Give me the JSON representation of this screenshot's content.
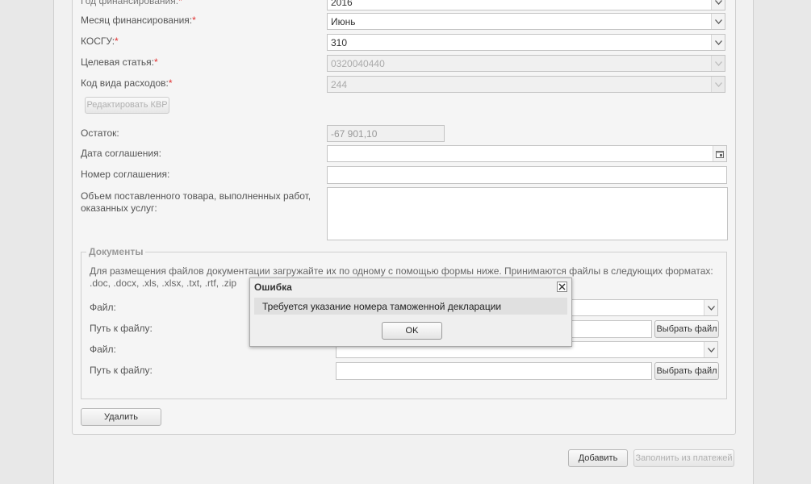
{
  "form": {
    "year": {
      "label": "Год финансирования:",
      "required_mark": "*",
      "value": "2016"
    },
    "month": {
      "label": "Месяц финансирования:",
      "required_mark": "*",
      "value": "Июнь"
    },
    "kosgu": {
      "label": "КОСГУ:",
      "required_mark": "*",
      "value": "310"
    },
    "target": {
      "label": "Целевая статья:",
      "required_mark": "*",
      "value": "0320040440"
    },
    "expense_code": {
      "label": "Код вида расходов:",
      "required_mark": "*",
      "value": "244"
    },
    "edit_kvr_button": "Редактировать КВР",
    "remainder": {
      "label": "Остаток:",
      "value": "-67 901,10"
    },
    "agreement_date": {
      "label": "Дата соглашения:",
      "value": ""
    },
    "agreement_number": {
      "label": "Номер соглашения:",
      "value": ""
    },
    "volume": {
      "label_line1": "Объем поставленного товара, выполненных работ,",
      "label_line2": "оказанных услуг:",
      "value": ""
    }
  },
  "documents": {
    "legend": "Документы",
    "description_line1": "Для размещения файлов документации загружайте их по одному с помощью формы ниже. Принимаются файлы в следующих форматах:",
    "description_line2": ".doc, .docx, .xls, .xlsx, .txt, .rtf, .zip",
    "rows": [
      {
        "file_label": "Файл:",
        "path_label": "Путь к файлу:",
        "choose_button": "Выбрать файл"
      },
      {
        "file_label": "Файл:",
        "path_label": "Путь к файлу:",
        "choose_button": "Выбрать файл"
      }
    ]
  },
  "delete_button": "Удалить",
  "footer": {
    "add_button": "Добавить",
    "fill_button": "Заполнить из платежей"
  },
  "dialog": {
    "title": "Ошибка",
    "message": "Требуется указание номера таможенной декларации",
    "ok_button": "OK"
  },
  "colors": {
    "required": "#e03030",
    "background": "#e8e8e8",
    "panel": "#f5f5f5"
  }
}
